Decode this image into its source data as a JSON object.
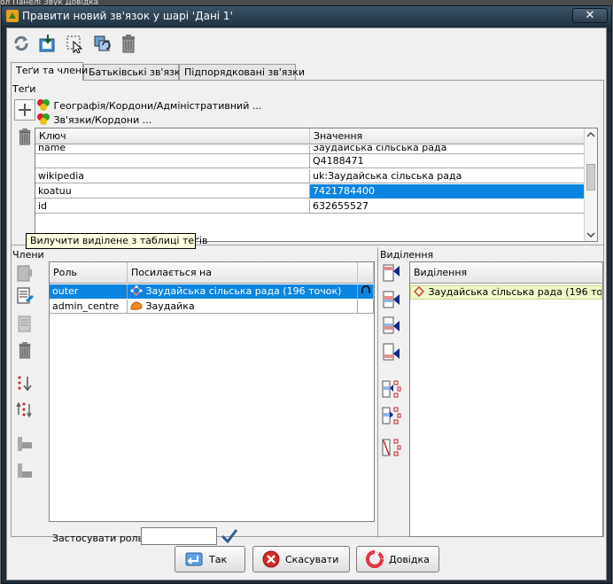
{
  "background_menu": "ол Панелі  Звук  Довідка",
  "window": {
    "title": "Правити новий зв'язок у шарі 'Дані 1'",
    "close_glyph": "✕"
  },
  "toolbar": {
    "buttons": [
      "refresh-icon",
      "download-icon",
      "select-icon",
      "copy-icon",
      "trash-icon"
    ]
  },
  "tabs": [
    {
      "label": "Теґи та члени",
      "active": true
    },
    {
      "label": "Батьківські зв'язки",
      "active": false
    },
    {
      "label": "Підпорядковані зв'язки",
      "active": false
    }
  ],
  "tags": {
    "section_label": "Теґи",
    "presets": [
      {
        "label": "Географія/Кордони/Адміністративний ..."
      },
      {
        "label": "Зв'язки/Кордони ..."
      }
    ],
    "header_key": "Ключ",
    "header_value": "Значення",
    "rows": [
      {
        "key": "name",
        "value": "Заудайська сільська рада",
        "selected": false
      },
      {
        "key": "",
        "value": "Q4188471",
        "selected": false
      },
      {
        "key": "wikipedia",
        "value": "uk:Заудайська сільська рада",
        "selected": false
      },
      {
        "key": "koatuu",
        "value": "7421784400",
        "selected": true
      },
      {
        "key": "id",
        "value": "632655527",
        "selected": false
      }
    ],
    "tooltip": "Вилучити виділене з таблиці теґів"
  },
  "members": {
    "section_label": "Члени",
    "header_role": "Роль",
    "header_ref": "Посилається на",
    "rows": [
      {
        "role": "outer",
        "ref": "Заудайська сільська рада (196 точок)",
        "selected": true
      },
      {
        "role": "admin_centre",
        "ref": "Заудайка",
        "selected": false
      }
    ],
    "apply_role_label": "Застосувати роль:",
    "apply_role_value": ""
  },
  "selection": {
    "section_label": "Виділення",
    "header": "Виділення",
    "items": [
      {
        "label": "Заудайська сільська рада (196 точок)"
      }
    ]
  },
  "buttons": {
    "ok": "Так",
    "cancel": "Скасувати",
    "help": "Довідка"
  },
  "colors": {
    "selection": "#0a84e0",
    "selection_item_bg": "#f0f7c8"
  }
}
